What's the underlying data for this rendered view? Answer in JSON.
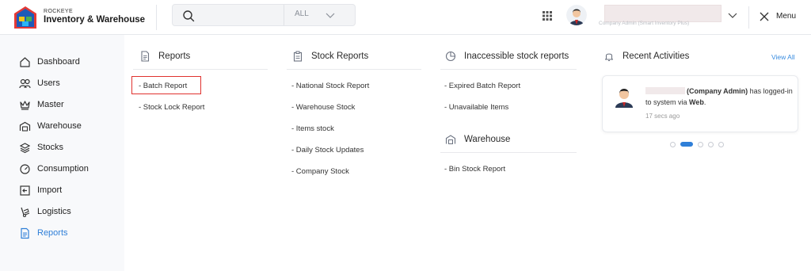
{
  "brand": {
    "small": "ROCKEYE",
    "name": "Inventory & Warehouse"
  },
  "search": {
    "value": "",
    "placeholder": "",
    "scope": "ALL"
  },
  "user": {
    "name": "",
    "sub": "Company Admin (Smart Inventory Plus)"
  },
  "menu_label": "Menu",
  "sidebar": {
    "items": [
      {
        "label": "Dashboard",
        "icon": "home-icon"
      },
      {
        "label": "Users",
        "icon": "users-icon"
      },
      {
        "label": "Master",
        "icon": "crown-icon"
      },
      {
        "label": "Warehouse",
        "icon": "warehouse-icon"
      },
      {
        "label": "Stocks",
        "icon": "layers-icon"
      },
      {
        "label": "Consumption",
        "icon": "gauge-icon"
      },
      {
        "label": "Import",
        "icon": "import-icon"
      },
      {
        "label": "Logistics",
        "icon": "hand-truck-icon"
      },
      {
        "label": "Reports",
        "icon": "report-icon",
        "active": true
      }
    ]
  },
  "columns": {
    "reports": {
      "title": "Reports",
      "links": [
        "- Batch Report",
        "- Stock Lock Report"
      ]
    },
    "stock_reports": {
      "title": "Stock Reports",
      "links": [
        "- National Stock Report",
        "- Warehouse Stock",
        "- Items stock",
        "- Daily Stock Updates",
        "- Company Stock"
      ]
    },
    "inaccessible": {
      "title": "Inaccessible stock reports",
      "links": [
        "- Expired Batch Report",
        "- Unavailable Items"
      ]
    },
    "warehouse": {
      "title": "Warehouse",
      "links": [
        "- Bin Stock Report"
      ]
    }
  },
  "activity": {
    "title": "Recent Activities",
    "view_all": "View All",
    "card": {
      "role": "(Company Admin)",
      "text1": " has logged-in to system via ",
      "via": "Web",
      "end": ".",
      "time": "17 secs ago"
    },
    "dots": 5,
    "active_dot": 1
  },
  "colors": {
    "accent": "#2f7fd8",
    "highlight": "#e0322f"
  }
}
